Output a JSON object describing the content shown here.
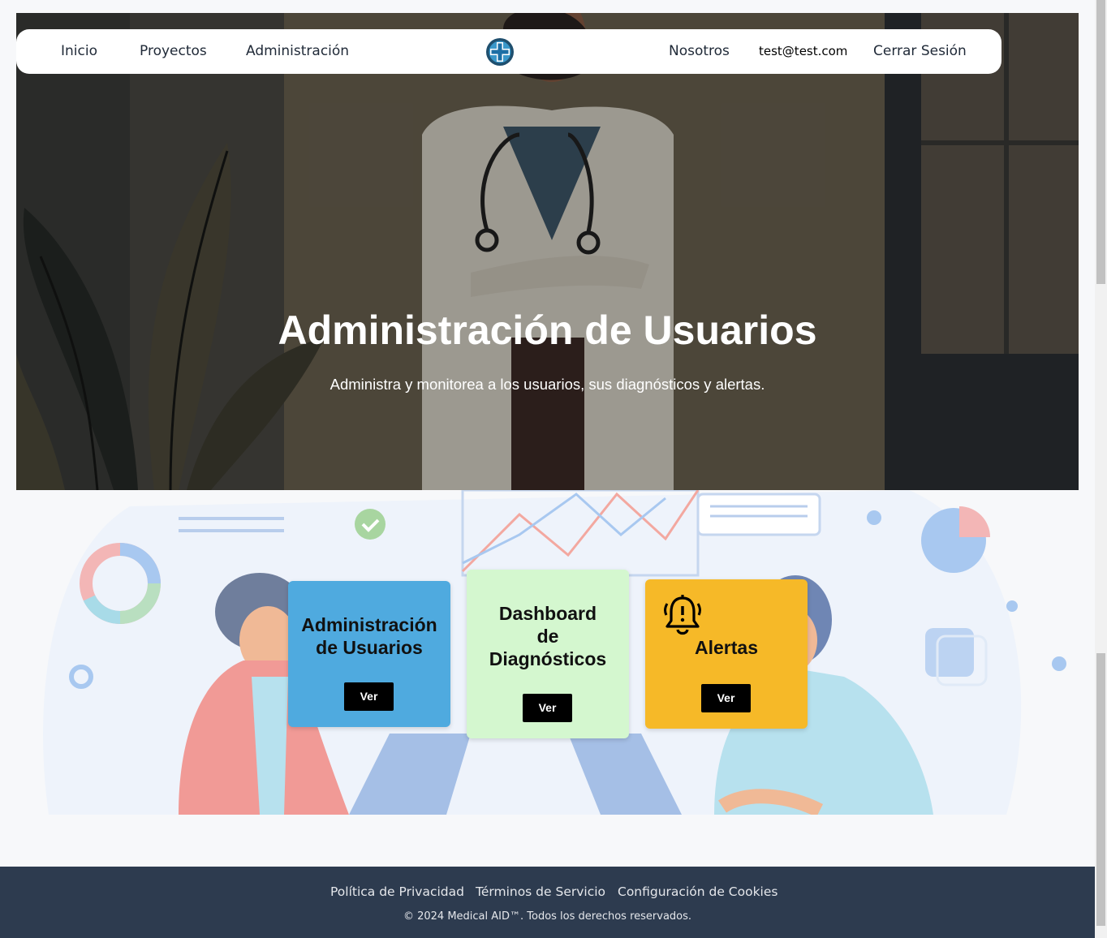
{
  "nav": {
    "links": [
      "Inicio",
      "Proyectos",
      "Administración"
    ],
    "about": "Nosotros",
    "email": "test@test.com",
    "logout": "Cerrar Sesión"
  },
  "hero": {
    "title": "Administración de Usuarios",
    "subtitle": "Administra y monitorea a los usuarios, sus diagnósticos y alertas."
  },
  "cards": [
    {
      "title_line1": "Administración",
      "title_line2": "de Usuarios",
      "button": "Ver",
      "color": "#4faadf"
    },
    {
      "title_line1": "Dashboard",
      "title_line2": "de",
      "title_line3": "Diagnósticos",
      "button": "Ver",
      "color": "#d4f7cf"
    },
    {
      "title": "Alertas",
      "button": "Ver",
      "icon": "bell-alert-icon",
      "color": "#f6b928"
    }
  ],
  "footer": {
    "links": [
      "Política de Privacidad",
      "Términos de Servicio",
      "Configuración de Cookies"
    ],
    "copyright": "© 2024 Medical AID™. Todos los derechos reservados."
  },
  "colors": {
    "footer_bg": "#2d3b4f",
    "button_bg": "#000000"
  }
}
